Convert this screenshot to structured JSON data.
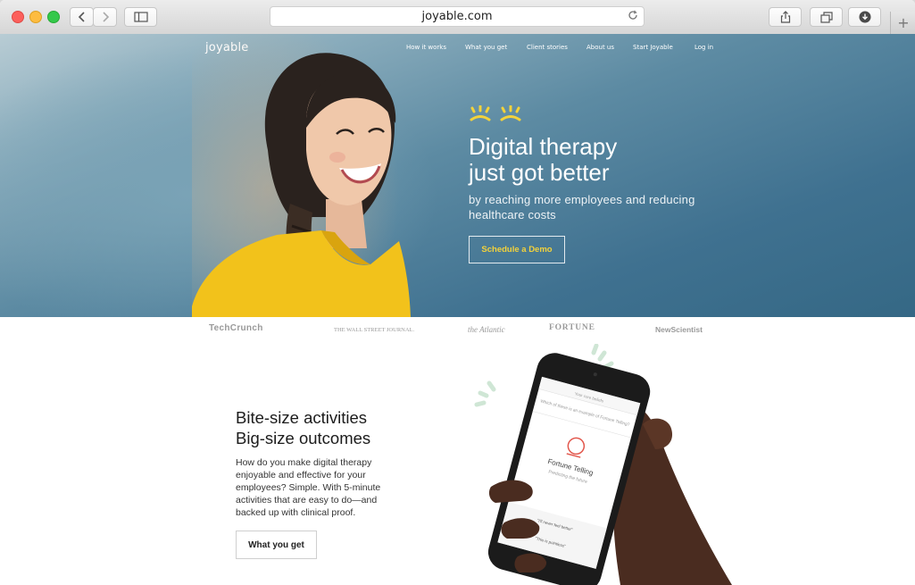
{
  "browser": {
    "url": "joyable.com",
    "colors": {
      "close": "#fc605c",
      "minimize": "#fdbc40",
      "zoom": "#34c84a"
    }
  },
  "site": {
    "logo": "joyable",
    "nav": [
      "How it works",
      "What you get",
      "Client stories",
      "About us",
      "Start Joyable",
      "Log in"
    ]
  },
  "hero": {
    "title_line1": "Digital therapy",
    "title_line2": "just got better",
    "subtitle_line1": "by reaching more employees and reducing",
    "subtitle_line2": "healthcare costs",
    "cta": "Schedule a Demo",
    "accent_color": "#f3d23b"
  },
  "press": [
    "TechCrunch",
    "THE WALL STREET JOURNAL.",
    "the Atlantic",
    "FORTUNE",
    "NewScientist"
  ],
  "feature": {
    "title_line1": "Bite-size activities",
    "title_line2": "Big-size outcomes",
    "body_lines": [
      "How do you make digital therapy",
      "enjoyable and effective for your",
      "employees? Simple. With 5-minute",
      "activities that are easy to do—and",
      "backed up with clinical proof."
    ],
    "button": "What you get"
  },
  "phone": {
    "header": "Your core beliefs",
    "question": "Which of these is an example of Fortune Telling?",
    "card_title": "Fortune Telling",
    "card_sub": "Predicting the future",
    "quote1": "\"I'll never feel better\"",
    "quote2": "\"This is pointless\""
  }
}
